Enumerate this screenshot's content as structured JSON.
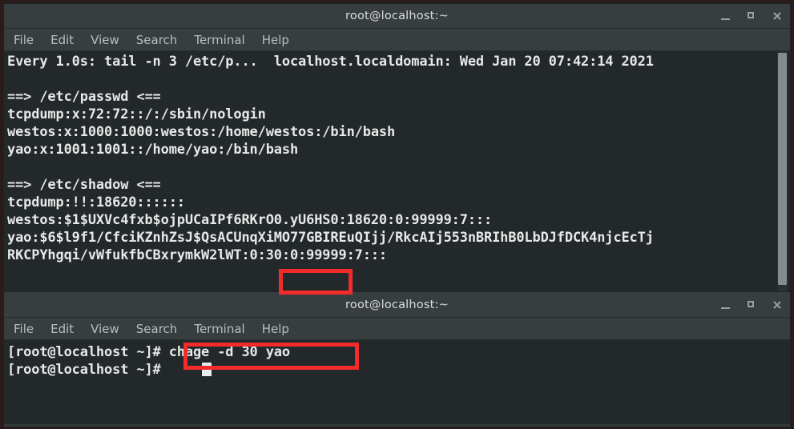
{
  "windows": {
    "top": {
      "title": "root@localhost:~",
      "menu": [
        "File",
        "Edit",
        "View",
        "Search",
        "Terminal",
        "Help"
      ],
      "controls": {
        "minimize": "minimize-icon",
        "maximize": "maximize-icon",
        "close": "close-icon"
      },
      "watch_header": "Every 1.0s: tail -n 3 /etc/p...  localhost.localdomain: Wed Jan 20 07:42:14 2021",
      "lines": [
        "",
        "==> /etc/passwd <==",
        "tcpdump:x:72:72::/:/sbin/nologin",
        "westos:x:1000:1000:westos:/home/westos:/bin/bash",
        "yao:x:1001:1001::/home/yao:/bin/bash",
        "",
        "==> /etc/shadow <==",
        "tcpdump:!!:18620::::::",
        "westos:$1$UXVc4fxb$ojpUCaIPf6RKrO0.yU6HS0:18620:0:99999:7:::",
        "yao:$6$l9f1/CfciKZnhZsJ$QsACUnqXiMO77GBIREuQIjj/RkcAIj553nBRIhB0LbDJfDCK4njcEcTj",
        "RKCPYhgqi/vWfukfbCBxrymkW2lWT:0:30:0:99999:7:::"
      ]
    },
    "bottom": {
      "title": "root@localhost:~",
      "menu": [
        "File",
        "Edit",
        "View",
        "Search",
        "Terminal",
        "Help"
      ],
      "controls": {
        "minimize": "minimize-icon",
        "maximize": "maximize-icon",
        "close": "close-icon"
      },
      "lines": [
        "[root@localhost ~]# chage -d 30 yao",
        "[root@localhost ~]# "
      ]
    }
  },
  "annotations": {
    "shadow_field_highlight": "0:30:0",
    "command_highlight": "chage -d 30 yao",
    "color": "#f32b2b"
  }
}
